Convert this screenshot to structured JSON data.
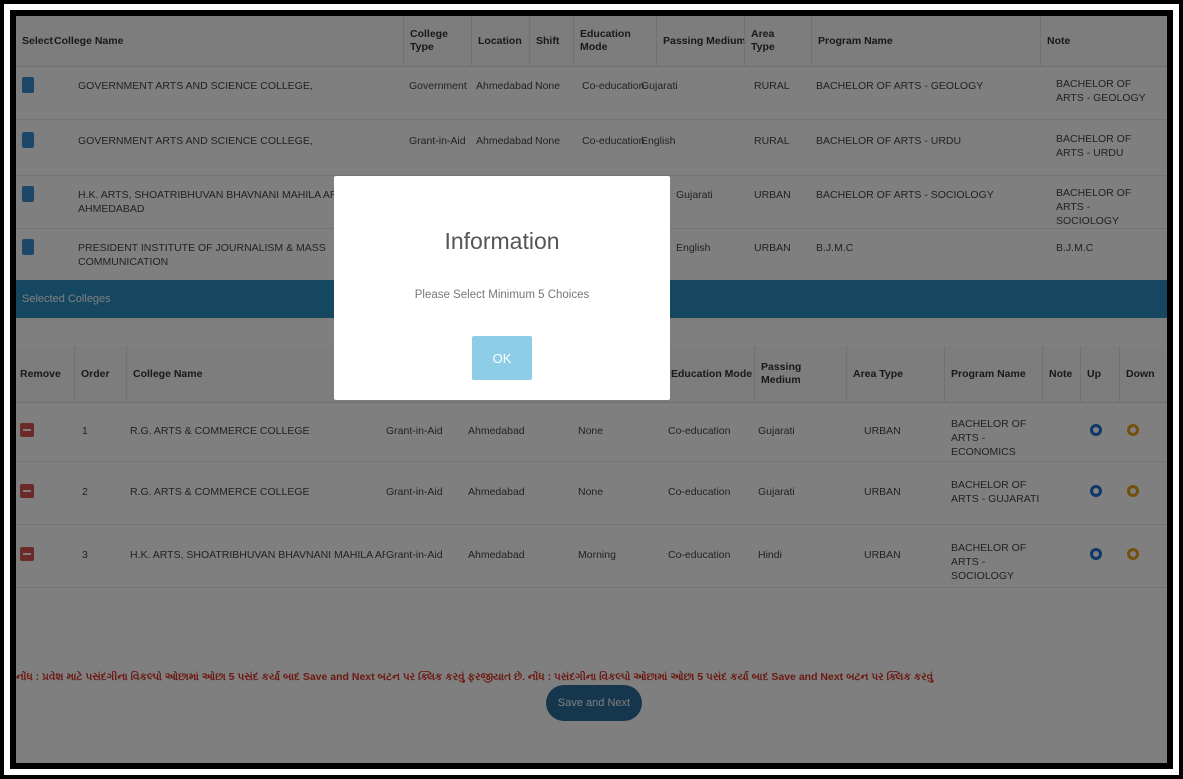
{
  "available": {
    "headers": {
      "select": "Select",
      "college_name": "College Name",
      "college_type": "College Type",
      "location": "Location",
      "shift": "Shift",
      "education_mode": "Education Mode",
      "passing_medium": "Passing Medium",
      "area_type": "Area Type",
      "program_name": "Program Name",
      "note": "Note"
    },
    "rows": [
      {
        "college_name": "GOVERNMENT ARTS AND SCIENCE COLLEGE,",
        "college_type": "Government",
        "location": "Ahmedabad",
        "shift": "None",
        "education_mode": "Co-education",
        "passing_medium": "Gujarati",
        "area_type": "RURAL",
        "program_name": "BACHELOR OF ARTS - GEOLOGY",
        "note": "BACHELOR OF ARTS - GEOLOGY"
      },
      {
        "college_name": "GOVERNMENT ARTS AND SCIENCE COLLEGE,",
        "college_type": "Grant-in-Aid",
        "location": "Ahmedabad",
        "shift": "None",
        "education_mode": "Co-education",
        "passing_medium": "English",
        "area_type": "RURAL",
        "program_name": "BACHELOR OF ARTS - URDU",
        "note": "BACHELOR OF ARTS - URDU"
      },
      {
        "college_name": "H.K. ARTS, SHOATRIBHUVAN BHAVNANI MAHILA ARTS, AHMEDABAD",
        "college_type": "",
        "location": "",
        "shift": "",
        "education_mode": "",
        "passing_medium": "Gujarati",
        "area_type": "URBAN",
        "program_name": "BACHELOR OF ARTS - SOCIOLOGY",
        "note": "BACHELOR OF ARTS - SOCIOLOGY"
      },
      {
        "college_name": "PRESIDENT INSTITUTE OF JOURNALISM & MASS COMMUNICATION",
        "college_type": "",
        "location": "",
        "shift": "",
        "education_mode": "",
        "passing_medium": "English",
        "area_type": "URBAN",
        "program_name": "B.J.M.C",
        "note": "B.J.M.C"
      }
    ]
  },
  "selected_bar": "Selected Colleges",
  "selected": {
    "headers": {
      "remove": "Remove",
      "order": "Order",
      "college_name": "College Name",
      "education_mode": "Education Mode",
      "passing_medium": "Passing Medium",
      "area_type": "Area Type",
      "program_name": "Program Name",
      "note": "Note",
      "up": "Up",
      "down": "Down"
    },
    "rows": [
      {
        "order": "1",
        "college_name": "R.G. ARTS & COMMERCE COLLEGE",
        "college_type": "Grant-in-Aid",
        "location": "Ahmedabad",
        "shift": "None",
        "education_mode": "Co-education",
        "passing_medium": "Gujarati",
        "area_type": "URBAN",
        "program_name": "BACHELOR OF ARTS - ECONOMICS"
      },
      {
        "order": "2",
        "college_name": "R.G. ARTS & COMMERCE COLLEGE",
        "college_type": "Grant-in-Aid",
        "location": "Ahmedabad",
        "shift": "None",
        "education_mode": "Co-education",
        "passing_medium": "Gujarati",
        "area_type": "URBAN",
        "program_name": "BACHELOR OF ARTS - GUJARATI"
      },
      {
        "order": "3",
        "college_name": "H.K. ARTS, SHOATRIBHUVAN BHAVNANI MAHILA ARTS, AHMEDABAD",
        "college_type": "Grant-in-Aid",
        "location": "Ahmedabad",
        "shift": "Morning",
        "education_mode": "Co-education",
        "passing_medium": "Hindi",
        "area_type": "URBAN",
        "program_name": "BACHELOR OF ARTS - SOCIOLOGY"
      }
    ]
  },
  "notice": "નોંધ : પ્રવેશ માટે પસંદગીના વિકલ્પો ઓછામાં ઓછા 5 પસંદ કર્યા બાદ Save and Next બટન પર ક્લિક કરવું ફરજીયાત છે. નોંધ : પસંદગીના વિકલ્પો ઓછામાં ઓછા 5 પસંદ કર્યા બાદ Save and Next બટન પર ક્લિક કરવું",
  "save_button": "Save and Next",
  "modal": {
    "title": "Information",
    "message": "Please Select Minimum 5 Choices",
    "ok": "OK"
  },
  "colors": {
    "accent": "#2a8ec0",
    "remove": "#d9534f",
    "notice": "#d63327",
    "ok": "#8ecde8"
  }
}
